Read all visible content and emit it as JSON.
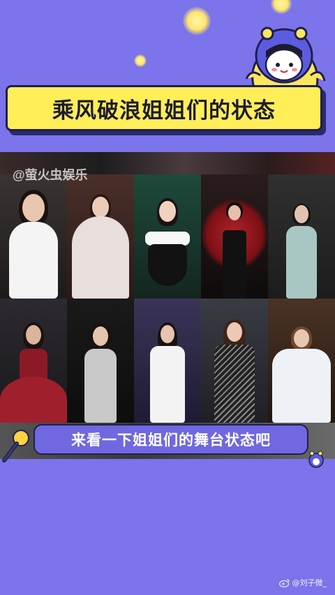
{
  "title": "乘风破浪姐姐们的状态",
  "watermark": "@萤火虫娱乐",
  "caption": "来看一下姐姐们的舞台状态吧",
  "footer": {
    "handle": "@刘子微_"
  },
  "colors": {
    "background": "#7b74ea",
    "banner": "#ffee58",
    "outline": "#1f1f4d",
    "caption_bg": "#6f68e0"
  },
  "icons": [
    "sparkle",
    "mascot",
    "microphone-icon",
    "small-mascot-icon",
    "weibo-icon"
  ]
}
